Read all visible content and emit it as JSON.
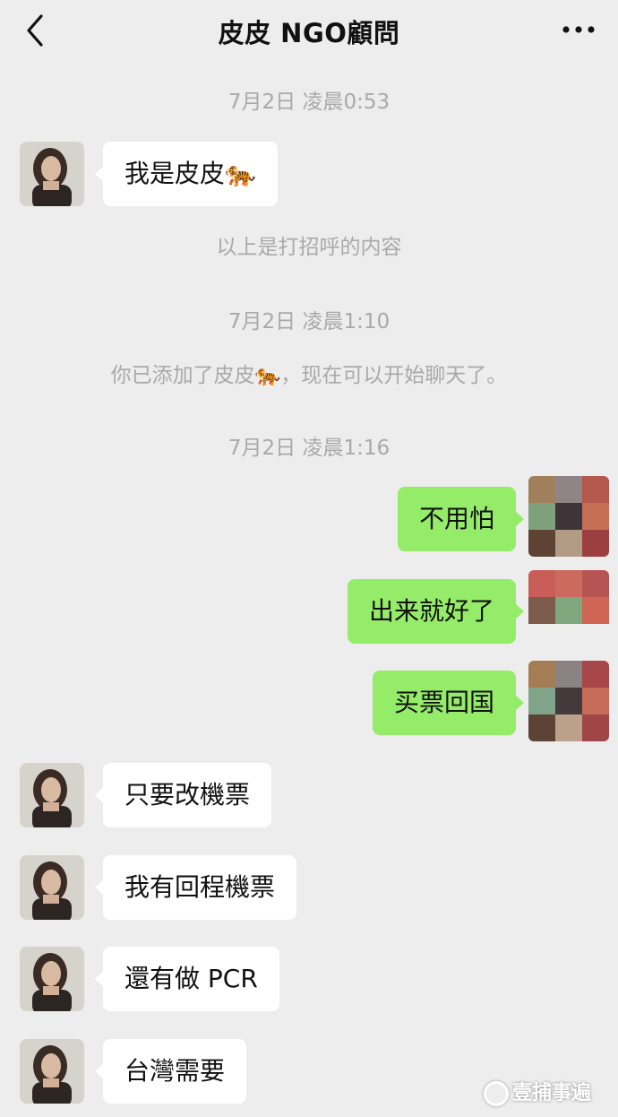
{
  "header": {
    "title": "皮皮 NGO顧問",
    "back_icon": "chevron-left-icon",
    "more_icon": "more-dots-icon"
  },
  "timestamps": {
    "t1": "7月2日 凌晨0:53",
    "t2": "7月2日 凌晨1:10",
    "t3": "7月2日 凌晨1:16"
  },
  "system": {
    "greeting_note": "以上是打招呼的内容",
    "added_note": "你已添加了皮皮🐅，现在可以开始聊天了。"
  },
  "messages": {
    "m1": "我是皮皮🐅",
    "m2": "不用怕",
    "m3": "出来就好了",
    "m4": "买票回国",
    "m5": "只要改機票",
    "m6": "我有回程機票",
    "m7": "還有做 PCR",
    "m8": "台灣需要"
  },
  "watermark": {
    "text": "壹捕事遍"
  },
  "colors": {
    "background": "#ededed",
    "bubble_left": "#ffffff",
    "bubble_right": "#95ec69",
    "meta_text": "#a9a9a9"
  }
}
